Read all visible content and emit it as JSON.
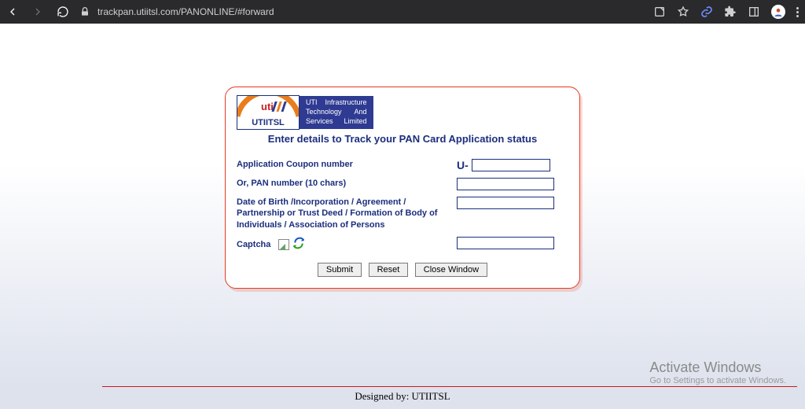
{
  "browser": {
    "url": "trackpan.utiitsl.com/PANONLINE/#forward"
  },
  "logo": {
    "brand_top": "uti",
    "brand_bottom": "UTIITSL",
    "line1a": "UTI",
    "line1b": "Infrastructure",
    "line2a": "Technology",
    "line2b": "And",
    "line3a": "Services",
    "line3b": "Limited"
  },
  "title": "Enter details to Track your PAN Card Application status",
  "form": {
    "coupon_label": "Application Coupon number",
    "coupon_prefix": "U-",
    "coupon_value": "",
    "pan_label": "Or, PAN number (10 chars)",
    "pan_value": "",
    "dob_label": "Date of Birth /Incorporation / Agreement / Partnership or Trust Deed / Formation of Body of Individuals / Association of Persons",
    "dob_value": "",
    "captcha_label": "Captcha",
    "captcha_value": ""
  },
  "buttons": {
    "submit": "Submit",
    "reset": "Reset",
    "close": "Close Window"
  },
  "footer": "Designed by: UTIITSL",
  "watermark": {
    "line1": "Activate Windows",
    "line2": "Go to Settings to activate Windows."
  }
}
